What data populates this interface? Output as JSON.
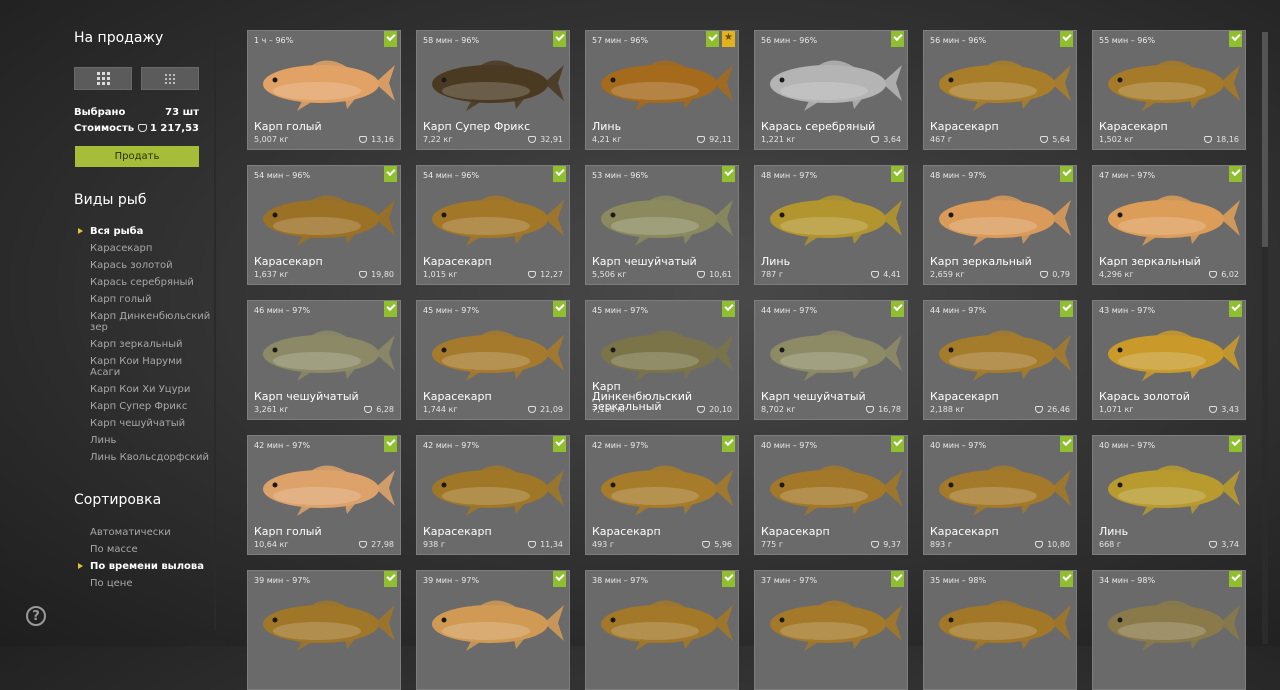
{
  "sidebar": {
    "title": "На продажу",
    "selected_label": "Выбрано",
    "selected_value": "73 шт",
    "cost_label": "Стоимость",
    "cost_value": "1 217,53",
    "sell_button": "Продать",
    "fish_types_title": "Виды рыб",
    "fish_types": [
      {
        "label": "Вся рыба",
        "active": true
      },
      {
        "label": "Карасекарп",
        "active": false
      },
      {
        "label": "Карась золотой",
        "active": false
      },
      {
        "label": "Карась серебряный",
        "active": false
      },
      {
        "label": "Карп голый",
        "active": false
      },
      {
        "label": "Карп Динкенбюльский зер",
        "active": false
      },
      {
        "label": "Карп зеркальный",
        "active": false
      },
      {
        "label": "Карп Кои Наруми Асаги",
        "active": false
      },
      {
        "label": "Карп Кои Хи Уцури",
        "active": false
      },
      {
        "label": "Карп Супер Фрикс",
        "active": false
      },
      {
        "label": "Карп чешуйчатый",
        "active": false
      },
      {
        "label": "Линь",
        "active": false
      },
      {
        "label": "Линь Квольсдорфский",
        "active": false
      }
    ],
    "sort_title": "Сортировка",
    "sort_options": [
      {
        "label": "Автоматически",
        "active": false
      },
      {
        "label": "По массе",
        "active": false
      },
      {
        "label": "По времени вылова",
        "active": true
      },
      {
        "label": "По цене",
        "active": false
      }
    ],
    "help_icon": "?"
  },
  "colors": {
    "accent_green": "#a6bd3a",
    "check_green": "#8fbf2f",
    "favorite_gold": "#e3b31e"
  },
  "fish_cards": [
    {
      "meta": "1 ч – 96%",
      "name": "Карп голый",
      "weight": "5,007 кг",
      "price": "13,16",
      "star": false,
      "color": "#e2a265"
    },
    {
      "meta": "58 мин – 96%",
      "name": "Карп Супер Фрикс",
      "weight": "7,22 кг",
      "price": "32,91",
      "star": false,
      "color": "#4a3a22"
    },
    {
      "meta": "57 мин – 96%",
      "name": "Линь",
      "weight": "4,21 кг",
      "price": "92,11",
      "star": true,
      "color": "#a56a1c"
    },
    {
      "meta": "56 мин – 96%",
      "name": "Карась серебряный",
      "weight": "1,221 кг",
      "price": "3,64",
      "star": false,
      "color": "#b4b4b4"
    },
    {
      "meta": "56 мин – 96%",
      "name": "Карасекарп",
      "weight": "467 г",
      "price": "5,64",
      "star": false,
      "color": "#a97e2a"
    },
    {
      "meta": "55 мин – 96%",
      "name": "Карасекарп",
      "weight": "1,502 кг",
      "price": "18,16",
      "star": false,
      "color": "#a57a28"
    },
    {
      "meta": "54 мин – 96%",
      "name": "Карасекарп",
      "weight": "1,637 кг",
      "price": "19,80",
      "star": false,
      "color": "#9b7125"
    },
    {
      "meta": "54 мин – 96%",
      "name": "Карасекарп",
      "weight": "1,015 кг",
      "price": "12,27",
      "star": false,
      "color": "#a27728"
    },
    {
      "meta": "53 мин – 96%",
      "name": "Карп чешуйчатый",
      "weight": "5,506 кг",
      "price": "10,61",
      "star": false,
      "color": "#8a8a5e"
    },
    {
      "meta": "48 мин – 97%",
      "name": "Линь",
      "weight": "787 г",
      "price": "4,41",
      "star": false,
      "color": "#b2952e"
    },
    {
      "meta": "48 мин – 97%",
      "name": "Карп зеркальный",
      "weight": "2,659 кг",
      "price": "0,79",
      "star": false,
      "color": "#d99a5a"
    },
    {
      "meta": "47 мин – 97%",
      "name": "Карп зеркальный",
      "weight": "4,296 кг",
      "price": "6,02",
      "star": false,
      "color": "#dc9d58"
    },
    {
      "meta": "46 мин – 97%",
      "name": "Карп чешуйчатый",
      "weight": "3,261 кг",
      "price": "6,28",
      "star": false,
      "color": "#8c8a66"
    },
    {
      "meta": "45 мин – 97%",
      "name": "Карасекарп",
      "weight": "1,744 кг",
      "price": "21,09",
      "star": false,
      "color": "#a67a2c"
    },
    {
      "meta": "45 мин – 97%",
      "name": "Карп Динкенбюльский зеркальный",
      "weight": "7,166 кг",
      "price": "20,10",
      "star": false,
      "color": "#7a7448"
    },
    {
      "meta": "44 мин – 97%",
      "name": "Карп чешуйчатый",
      "weight": "8,702 кг",
      "price": "16,78",
      "star": false,
      "color": "#8d8b66"
    },
    {
      "meta": "44 мин – 97%",
      "name": "Карасекарп",
      "weight": "2,188 кг",
      "price": "26,46",
      "star": false,
      "color": "#a57b2c"
    },
    {
      "meta": "43 мин – 97%",
      "name": "Карась золотой",
      "weight": "1,071 кг",
      "price": "3,43",
      "star": false,
      "color": "#c99a2a"
    },
    {
      "meta": "42 мин – 97%",
      "name": "Карп голый",
      "weight": "10,64 кг",
      "price": "27,98",
      "star": false,
      "color": "#dca26a"
    },
    {
      "meta": "42 мин – 97%",
      "name": "Карасекарп",
      "weight": "938 г",
      "price": "11,34",
      "star": false,
      "color": "#a07727"
    },
    {
      "meta": "42 мин – 97%",
      "name": "Карасекарп",
      "weight": "493 г",
      "price": "5,96",
      "star": false,
      "color": "#a67b2a"
    },
    {
      "meta": "40 мин – 97%",
      "name": "Карасекарп",
      "weight": "775 г",
      "price": "9,37",
      "star": false,
      "color": "#a37828"
    },
    {
      "meta": "40 мин – 97%",
      "name": "Карасекарп",
      "weight": "893 г",
      "price": "10,80",
      "star": false,
      "color": "#a47929"
    },
    {
      "meta": "40 мин – 97%",
      "name": "Линь",
      "weight": "668 г",
      "price": "3,74",
      "star": false,
      "color": "#b89a2e"
    },
    {
      "meta": "39 мин – 97%",
      "name": "",
      "weight": "",
      "price": "",
      "star": false,
      "color": "#a07628"
    },
    {
      "meta": "39 мин – 97%",
      "name": "",
      "weight": "",
      "price": "",
      "star": false,
      "color": "#d09a55"
    },
    {
      "meta": "38 мин – 97%",
      "name": "",
      "weight": "",
      "price": "",
      "star": false,
      "color": "#a37828"
    },
    {
      "meta": "37 мин – 97%",
      "name": "",
      "weight": "",
      "price": "",
      "star": false,
      "color": "#a47929"
    },
    {
      "meta": "35 мин – 98%",
      "name": "",
      "weight": "",
      "price": "",
      "star": false,
      "color": "#a27727"
    },
    {
      "meta": "34 мин – 98%",
      "name": "",
      "weight": "",
      "price": "",
      "star": false,
      "color": "#8a7a4a"
    }
  ]
}
